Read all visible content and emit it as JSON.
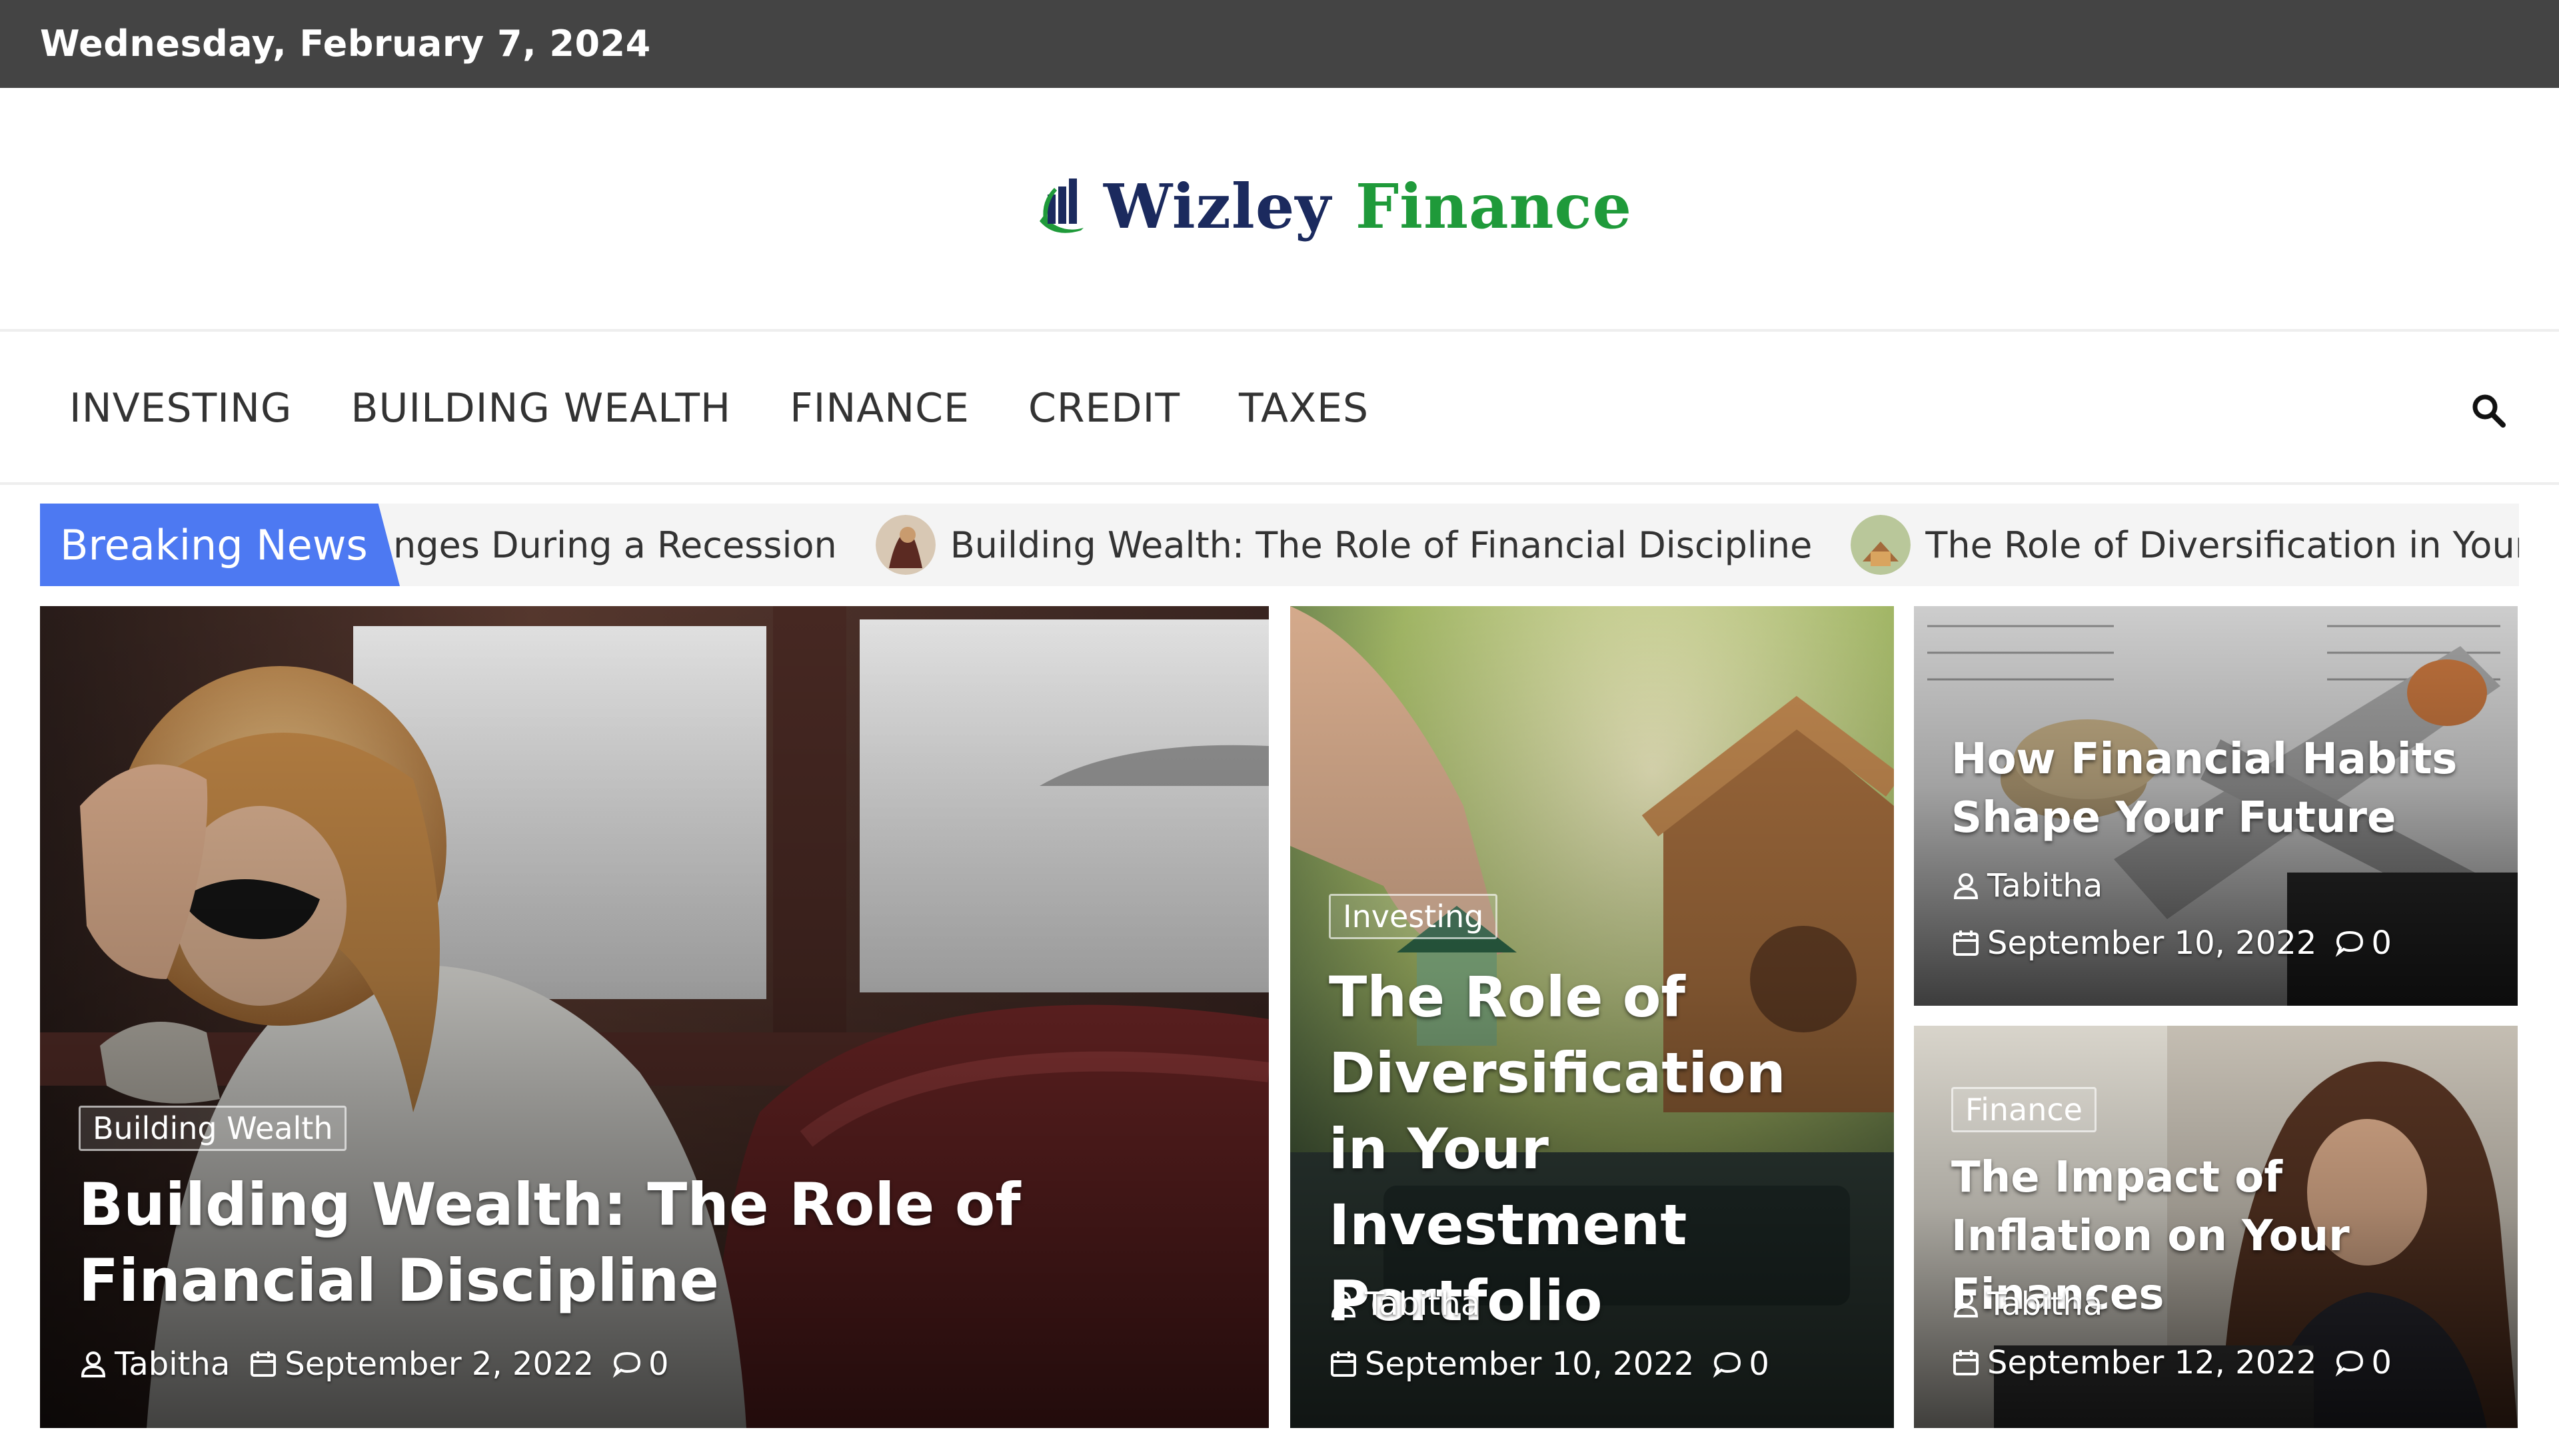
{
  "topbar": {
    "date": "Wednesday, February 7, 2024"
  },
  "logo": {
    "word1": "Wizley",
    "word2": "Finance"
  },
  "nav": {
    "items": [
      "INVESTING",
      "BUILDING WEALTH",
      "FINANCE",
      "CREDIT",
      "TAXES"
    ],
    "search_icon": "search-icon"
  },
  "ticker": {
    "label": "Breaking News",
    "items": [
      "nges During a Recession",
      "Building Wealth: The Role of Financial Discipline",
      "The Role of Diversification in Your Inve"
    ]
  },
  "featured": [
    {
      "category": "Building Wealth",
      "title": "Building Wealth: The Role of Financial Discipline",
      "author": "Tabitha",
      "date": "September 2, 2022",
      "comments": "0"
    },
    {
      "category": "Investing",
      "title": "The Role of Diversification in Your Investment Portfolio",
      "author": "Tabitha",
      "date": "September 10, 2022",
      "comments": "0"
    },
    {
      "category": "Finance",
      "title": "How Financial Habits Shape Your Future",
      "author": "Tabitha",
      "date": "September 10, 2022",
      "comments": "0"
    },
    {
      "category": "Finance",
      "title": "The Impact of Inflation on Your Finances",
      "author": "Tabitha",
      "date": "September 12, 2022",
      "comments": "0"
    }
  ],
  "colors": {
    "topbar": "#444444",
    "breaking": "#4d79f2",
    "logo_blue": "#1b2a5e",
    "logo_green": "#1f9a3a"
  }
}
